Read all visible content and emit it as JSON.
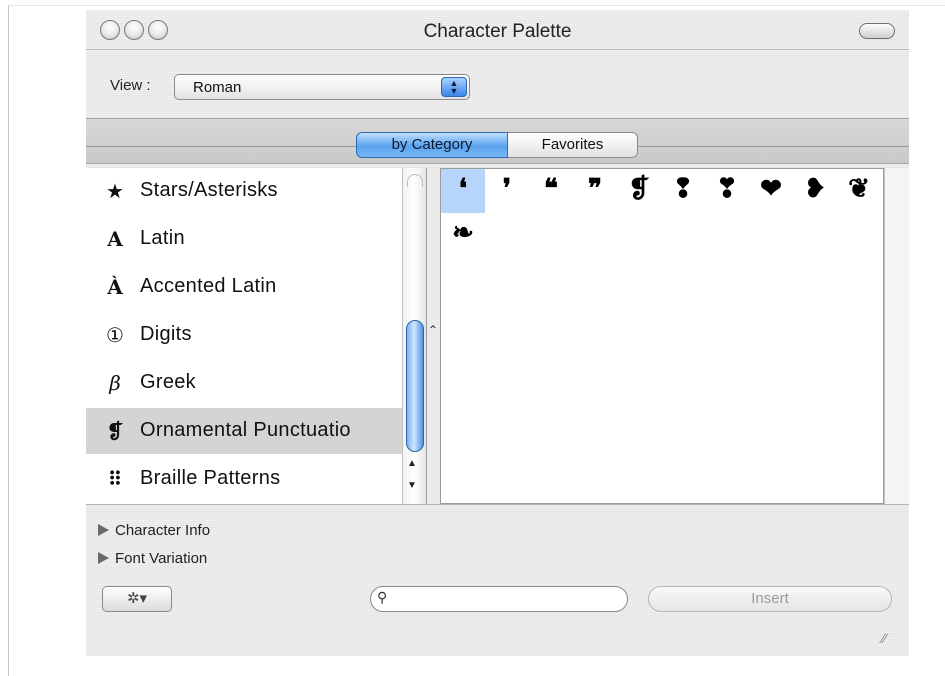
{
  "window": {
    "title": "Character Palette"
  },
  "view": {
    "label": "View :",
    "value": "Roman"
  },
  "tabs": [
    {
      "label": "by Category",
      "selected": true
    },
    {
      "label": "Favorites",
      "selected": false
    }
  ],
  "categories": [
    {
      "icon": "★",
      "icon_name": "star-icon",
      "label": "Stars/Asterisks"
    },
    {
      "icon": "A",
      "icon_name": "latin-a-icon",
      "label": "Latin"
    },
    {
      "icon": "À",
      "icon_name": "accented-a-icon",
      "label": "Accented Latin"
    },
    {
      "icon": "①",
      "icon_name": "circled-one-icon",
      "label": "Digits"
    },
    {
      "icon": "β",
      "icon_name": "beta-icon",
      "label": "Greek"
    },
    {
      "icon": "❡",
      "icon_name": "pilcrow-icon",
      "label": "Ornamental Punctuatio",
      "selected": true
    },
    {
      "icon": "⠿",
      "icon_name": "braille-icon",
      "label": "Braille Patterns"
    }
  ],
  "glyphs": [
    "❛",
    "❜",
    "❝",
    "❞",
    "❡",
    "❢",
    "❣",
    "❤",
    "❥",
    "❦",
    "❧"
  ],
  "panels": {
    "character_info": "Character Info",
    "font_variation": "Font Variation"
  },
  "footer": {
    "gear_label": "✲▾",
    "search_placeholder": "",
    "search_icon": "🔍",
    "insert_label": "Insert"
  },
  "colors": {
    "selection_blue": "#b7d5fb",
    "accent_blue": "#5aa2ee",
    "category_selected": "#d4d4d4"
  }
}
